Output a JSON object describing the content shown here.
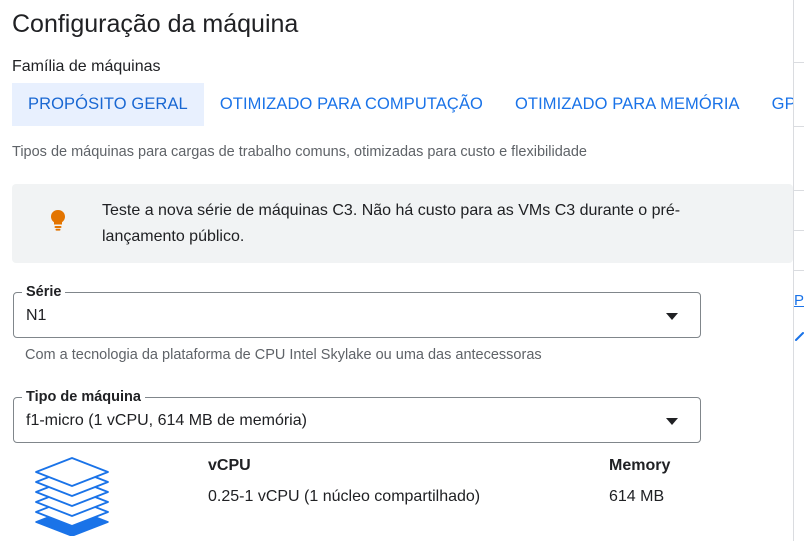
{
  "page": {
    "title": "Configuração da máquina"
  },
  "machine_family": {
    "label": "Família de máquinas",
    "tabs": [
      {
        "label": "PROPÓSITO GERAL",
        "active": true
      },
      {
        "label": "OTIMIZADO PARA COMPUTAÇÃO",
        "active": false
      },
      {
        "label": "OTIMIZADO PARA MEMÓRIA",
        "active": false
      },
      {
        "label": "GP",
        "active": false
      }
    ],
    "description": "Tipos de máquinas para cargas de trabalho comuns, otimizadas para custo e flexibilidade"
  },
  "banner": {
    "icon": "lightbulb-icon",
    "icon_color": "#e37400",
    "text": "Teste a nova série de máquinas C3. Não há custo para as VMs C3 durante o pré-lançamento público."
  },
  "series": {
    "label": "Série",
    "value": "N1",
    "helper": "Com a tecnologia da plataforma de CPU Intel Skylake ou uma das antecessoras"
  },
  "machine_type": {
    "label": "Tipo de máquina",
    "value": "f1-micro (1 vCPU, 614 MB de memória)"
  },
  "specs": {
    "icon": "layers-icon",
    "vcpu_header": "vCPU",
    "vcpu_value": "0.25-1 vCPU (1 núcleo compartilhado)",
    "memory_header": "Memory",
    "memory_value": "614 MB"
  },
  "side_panel": {
    "link_text": "P"
  },
  "colors": {
    "accent": "#1a73e8",
    "tab_active_bg": "#e8f0fe",
    "banner_bg": "#f1f3f4",
    "icon_blue": "#1a73e8"
  }
}
